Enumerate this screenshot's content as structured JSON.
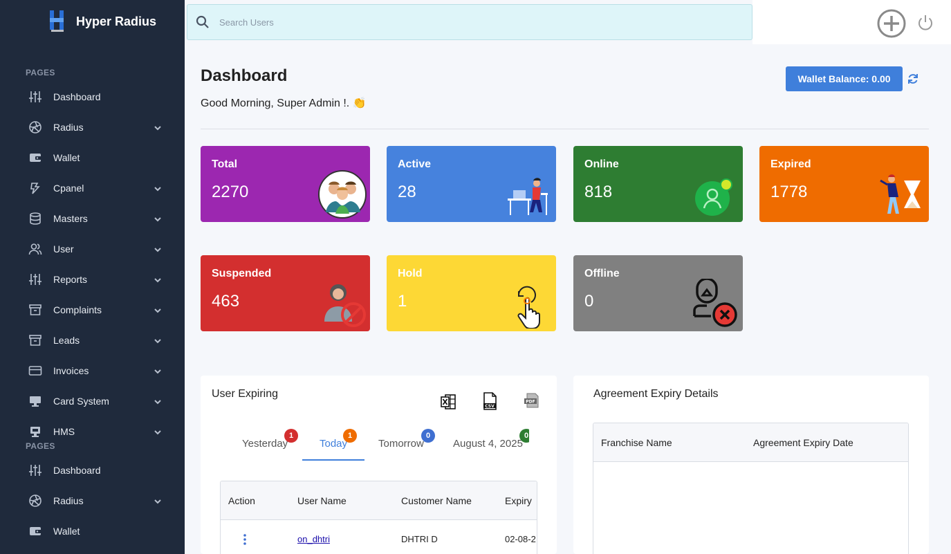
{
  "app": {
    "name": "Hyper Radius"
  },
  "sidebar": {
    "section_pages": "PAGES",
    "items": [
      {
        "label": "Dashboard"
      },
      {
        "label": "Radius"
      },
      {
        "label": "Wallet"
      },
      {
        "label": "Cpanel"
      },
      {
        "label": "Masters"
      },
      {
        "label": "User"
      },
      {
        "label": "Reports"
      },
      {
        "label": "Complaints"
      },
      {
        "label": "Leads"
      },
      {
        "label": "Invoices"
      },
      {
        "label": "Card System"
      },
      {
        "label": "HMS"
      }
    ],
    "section_pages_2": "PAGES",
    "items_2": [
      {
        "label": "Dashboard"
      },
      {
        "label": "Radius"
      },
      {
        "label": "Wallet"
      }
    ]
  },
  "header": {
    "search_placeholder": "Search Users"
  },
  "main": {
    "title": "Dashboard",
    "greeting": "Good Morning, Super Admin !. 👏",
    "wallet_label": "Wallet Balance: 0.00",
    "cards": [
      {
        "label": "Total",
        "value": "2270",
        "color": "#9c27b0"
      },
      {
        "label": "Active",
        "value": "28",
        "color": "#4682dd"
      },
      {
        "label": "Online",
        "value": "818",
        "color": "#2e7d32"
      },
      {
        "label": "Expired",
        "value": "1778",
        "color": "#ef6c00"
      },
      {
        "label": "Suspended",
        "value": "463",
        "color": "#d32f2f"
      },
      {
        "label": "Hold",
        "value": "1",
        "color": "#fdd835"
      },
      {
        "label": "Offline",
        "value": "0",
        "color": "#808080"
      }
    ]
  },
  "user_expiring": {
    "title": "User Expiring",
    "tabs": [
      {
        "label": "Yesterday",
        "count": "1",
        "badge_color": "#d32f2f"
      },
      {
        "label": "Today",
        "count": "1",
        "badge_color": "#ef6c00"
      },
      {
        "label": "Tomorrow",
        "count": "0",
        "badge_color": "#3f6fd1"
      },
      {
        "label": "August 4, 2025",
        "count": "0",
        "badge_color": "#2e7d32"
      }
    ],
    "columns": [
      "Action",
      "User Name",
      "Customer Name",
      "Expiry"
    ],
    "rows": [
      {
        "user_name": "on_dhtri",
        "customer_name": "DHTRI D",
        "expiry": "02-08-2"
      }
    ]
  },
  "agreement": {
    "title": "Agreement Expiry Details",
    "columns": [
      "Franchise Name",
      "Agreement Expiry Date"
    ]
  }
}
